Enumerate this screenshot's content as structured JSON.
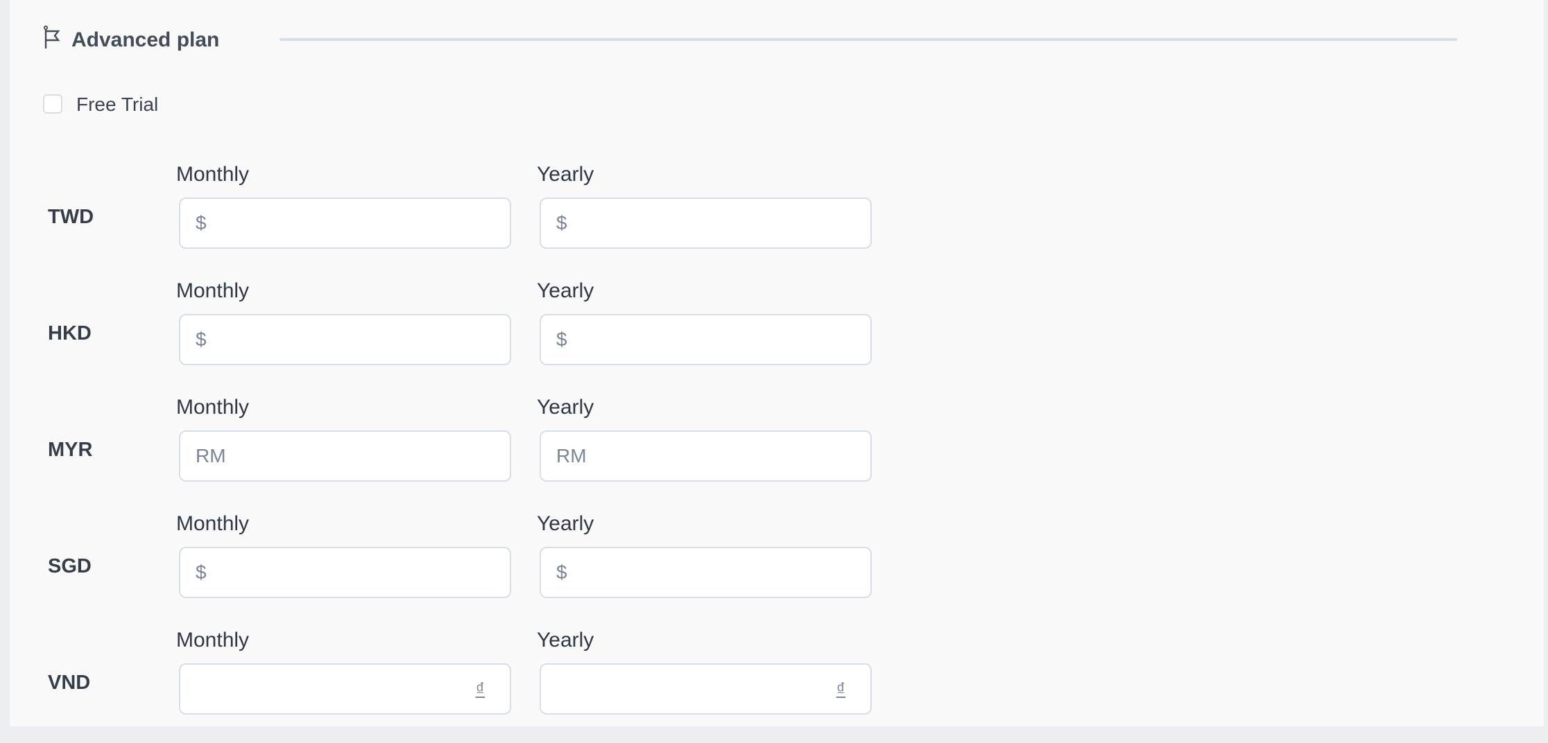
{
  "section": {
    "icon": "flag-icon",
    "title": "Advanced plan"
  },
  "free_trial": {
    "label": "Free Trial",
    "checked": false
  },
  "pricing": {
    "monthly_label": "Monthly",
    "yearly_label": "Yearly",
    "rows": [
      {
        "currency": "TWD",
        "monthly": {
          "value": "",
          "placeholder": "$",
          "suffix": ""
        },
        "yearly": {
          "value": "",
          "placeholder": "$",
          "suffix": ""
        }
      },
      {
        "currency": "HKD",
        "monthly": {
          "value": "",
          "placeholder": "$",
          "suffix": ""
        },
        "yearly": {
          "value": "",
          "placeholder": "$",
          "suffix": ""
        }
      },
      {
        "currency": "MYR",
        "monthly": {
          "value": "",
          "placeholder": "RM",
          "suffix": ""
        },
        "yearly": {
          "value": "",
          "placeholder": "RM",
          "suffix": ""
        }
      },
      {
        "currency": "SGD",
        "monthly": {
          "value": "",
          "placeholder": "$",
          "suffix": ""
        },
        "yearly": {
          "value": "",
          "placeholder": "$",
          "suffix": ""
        }
      },
      {
        "currency": "VND",
        "monthly": {
          "value": "",
          "placeholder": "",
          "suffix": "₫"
        },
        "yearly": {
          "value": "",
          "placeholder": "",
          "suffix": "₫"
        }
      }
    ]
  }
}
